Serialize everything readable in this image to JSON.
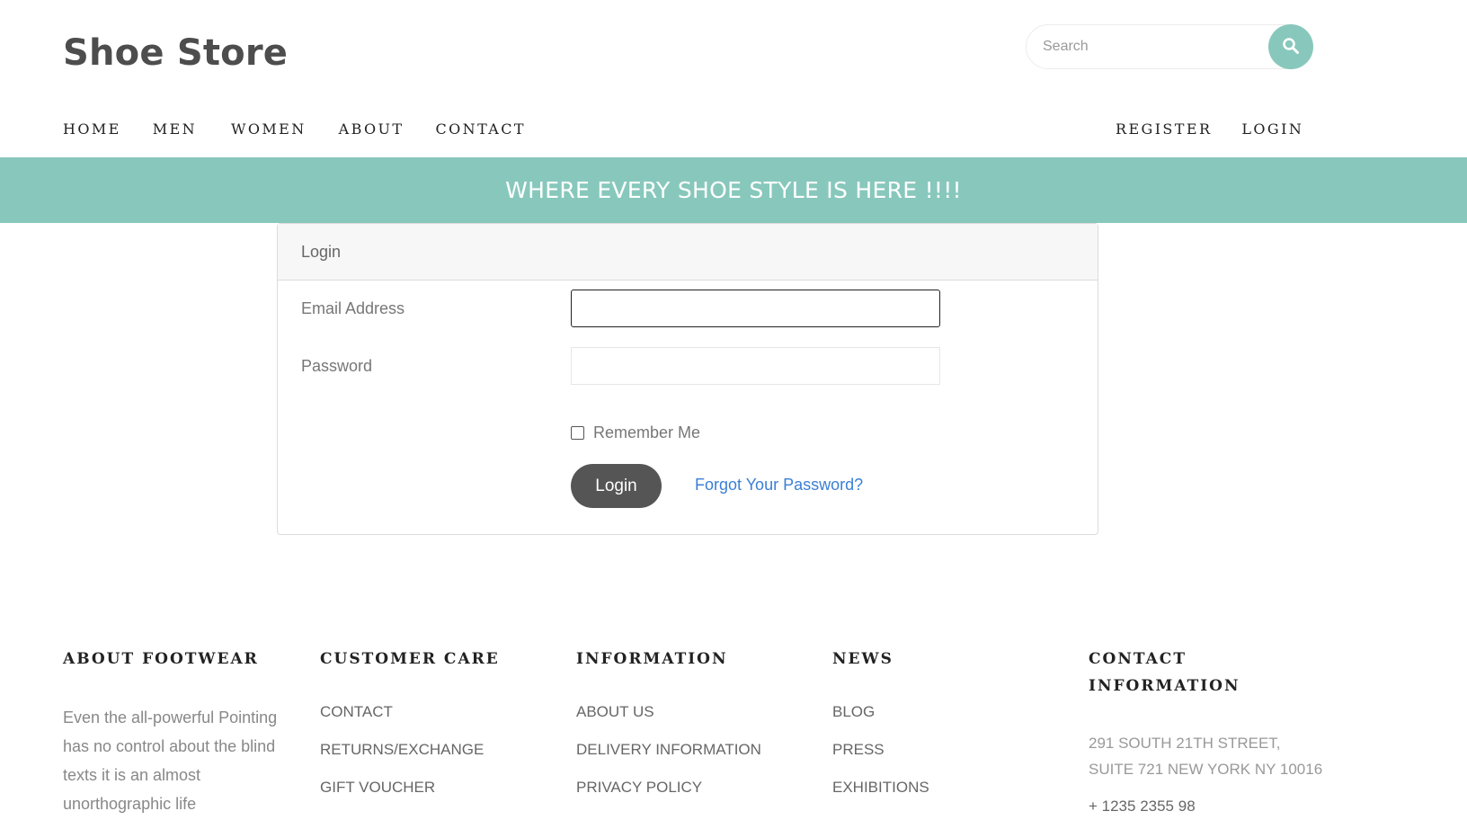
{
  "header": {
    "brand": "Shoe Store",
    "search": {
      "placeholder": "Search",
      "value": ""
    },
    "search_icon": "search-icon"
  },
  "nav": {
    "left": [
      {
        "label": "HOME"
      },
      {
        "label": "MEN"
      },
      {
        "label": "WOMEN"
      },
      {
        "label": "ABOUT"
      },
      {
        "label": "CONTACT"
      }
    ],
    "right": [
      {
        "label": "REGISTER"
      },
      {
        "label": "LOGIN"
      }
    ]
  },
  "banner": {
    "text": "WHERE EVERY SHOE STYLE IS HERE !!!!"
  },
  "login_card": {
    "title": "Login",
    "email_label": "Email Address",
    "email_value": "",
    "password_label": "Password",
    "password_value": "",
    "remember_label": "Remember Me",
    "remember_checked": false,
    "submit_label": "Login",
    "forgot_label": "Forgot Your Password?"
  },
  "footer": {
    "about": {
      "heading": "ABOUT FOOTWEAR",
      "text": "Even the all-powerful Pointing has no control about the blind texts it is an almost unorthographic life"
    },
    "customer_care": {
      "heading": "CUSTOMER CARE",
      "links": [
        "CONTACT",
        "RETURNS/EXCHANGE",
        "GIFT VOUCHER"
      ]
    },
    "information": {
      "heading": "INFORMATION",
      "links": [
        "ABOUT US",
        "DELIVERY INFORMATION",
        "PRIVACY POLICY"
      ]
    },
    "news": {
      "heading": "NEWS",
      "links": [
        "BLOG",
        "PRESS",
        "EXHIBITIONS"
      ]
    },
    "contact": {
      "heading_line1": "CONTACT",
      "heading_line2": "INFORMATION",
      "address_line1": "291 SOUTH 21TH STREET,",
      "address_line2": "SUITE 721 NEW YORK NY 10016",
      "phone": "+ 1235 2355 98"
    }
  },
  "colors": {
    "accent": "#88c8bc",
    "button_dark": "#555555",
    "link_blue": "#3b7fd6"
  }
}
